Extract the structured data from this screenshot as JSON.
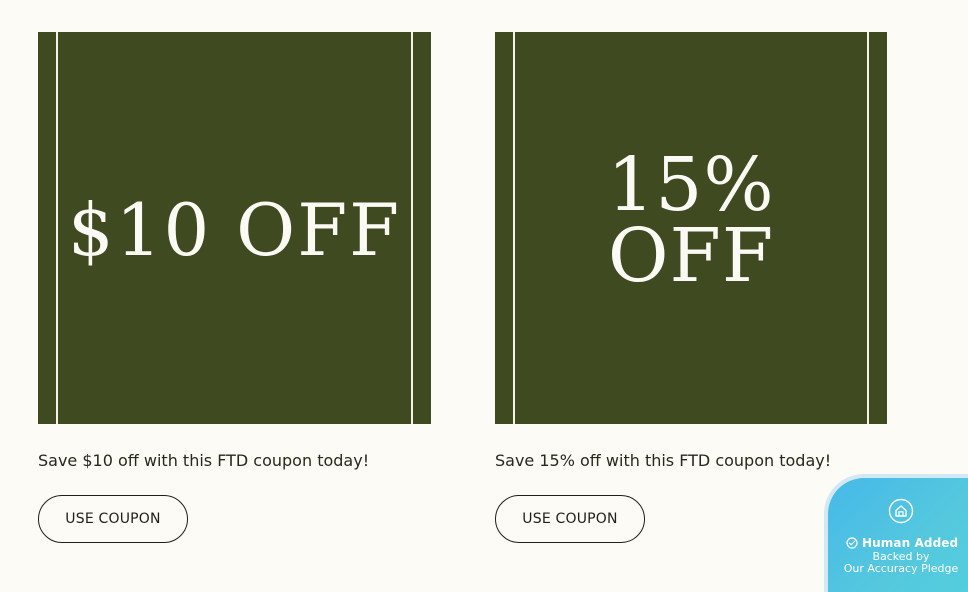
{
  "coupons": [
    {
      "art_text": "$10 OFF",
      "description": "Save $10 off with this FTD coupon today!",
      "button_label": "USE COUPON"
    },
    {
      "art_text": "15%\nOFF",
      "description": "Save 15% off with this FTD coupon today!",
      "button_label": "USE COUPON"
    }
  ],
  "pledge_badge": {
    "icon": "house-icon",
    "check_icon": "check-circle-icon",
    "title": "Human Added",
    "subtitle": "Backed by\nOur Accuracy Pledge"
  },
  "colors": {
    "background": "#fcfbf5",
    "coupon_art": "#3f4a21",
    "coupon_text": "#fbfaf4",
    "body_text": "#28281f",
    "badge_gradient_start": "#46b9e9",
    "badge_gradient_end": "#52d0de"
  }
}
